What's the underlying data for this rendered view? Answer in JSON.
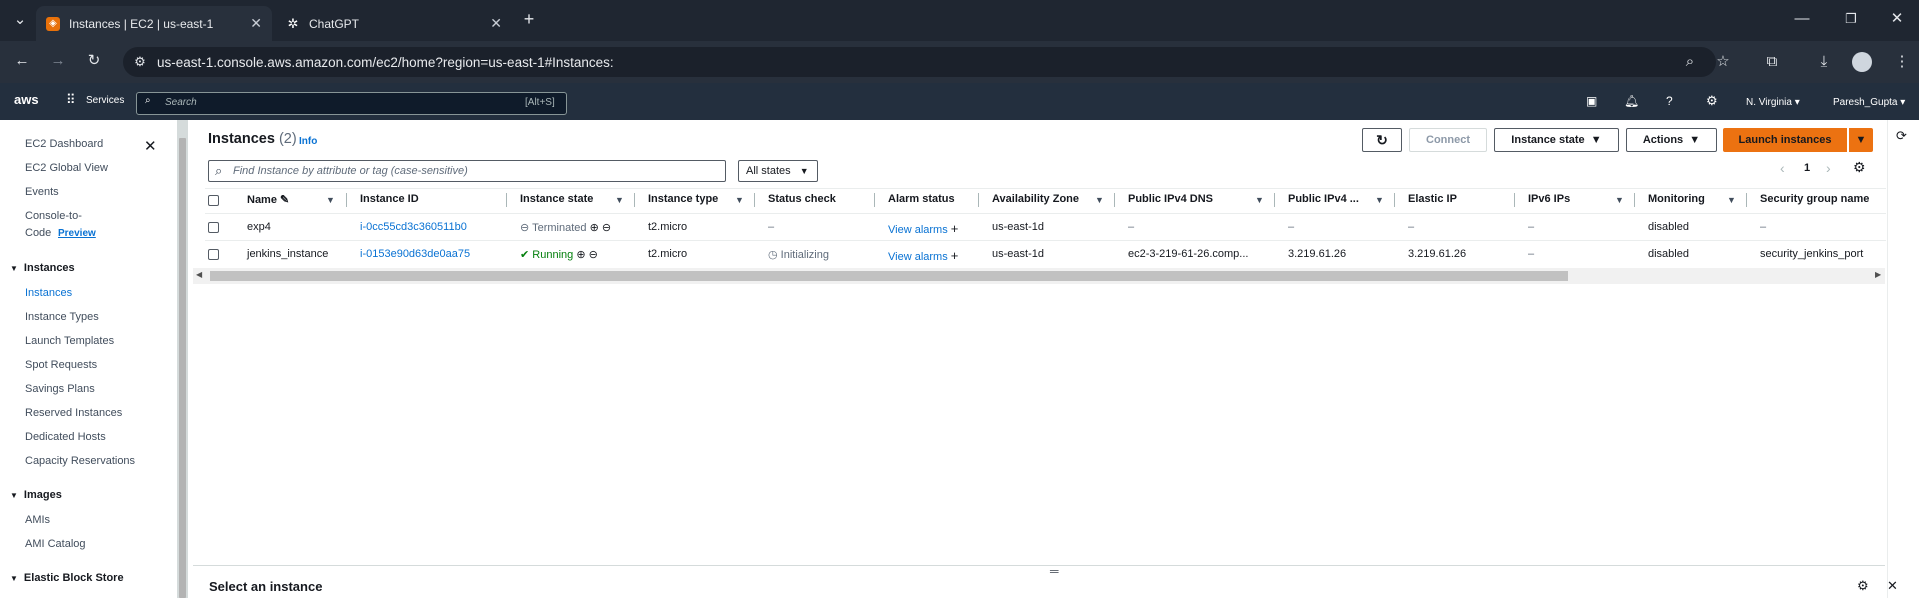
{
  "browser": {
    "tabs": [
      {
        "title": "Instances | EC2 | us-east-1",
        "active": true
      },
      {
        "title": "ChatGPT",
        "active": false
      }
    ],
    "url": "us-east-1.console.aws.amazon.com/ec2/home?region=us-east-1#Instances:"
  },
  "aws_nav": {
    "logo": "aws",
    "services": "Services",
    "search_placeholder": "Search",
    "search_shortcut": "[Alt+S]",
    "region": "N. Virginia",
    "user": "Paresh_Gupta"
  },
  "sidebar": {
    "top_items": [
      "EC2 Dashboard",
      "EC2 Global View",
      "Events",
      "Console-to-",
      "Code"
    ],
    "preview_badge": "Preview",
    "sections": [
      {
        "title": "Instances",
        "items": [
          "Instances",
          "Instance Types",
          "Launch Templates",
          "Spot Requests",
          "Savings Plans",
          "Reserved Instances",
          "Dedicated Hosts",
          "Capacity Reservations"
        ]
      },
      {
        "title": "Images",
        "items": [
          "AMIs",
          "AMI Catalog"
        ]
      },
      {
        "title": "Elastic Block Store",
        "items": []
      }
    ]
  },
  "main": {
    "title": "Instances",
    "count": "(2)",
    "info": "Info",
    "buttons": {
      "connect": "Connect",
      "instance_state": "Instance state",
      "actions": "Actions",
      "launch": "Launch instances"
    },
    "filter_placeholder": "Find Instance by attribute or tag (case-sensitive)",
    "state_filter": "All states",
    "page": "1",
    "columns": [
      "Name",
      "Instance ID",
      "Instance state",
      "Instance type",
      "Status check",
      "Alarm status",
      "Availability Zone",
      "Public IPv4 DNS",
      "Public IPv4 ...",
      "Elastic IP",
      "IPv6 IPs",
      "Monitoring",
      "Security group name"
    ],
    "rows": [
      {
        "name": "exp4",
        "id": "i-0cc55cd3c360511b0",
        "state": "Terminated",
        "type": "t2.micro",
        "status": "–",
        "alarm": "View alarms",
        "az": "us-east-1d",
        "dns": "–",
        "ipv4": "–",
        "eip": "–",
        "ipv6": "–",
        "monitoring": "disabled",
        "sg": "–"
      },
      {
        "name": "jenkins_instance",
        "id": "i-0153e90d63de0aa75",
        "state": "Running",
        "type": "t2.micro",
        "status": "Initializing",
        "alarm": "View alarms",
        "az": "us-east-1d",
        "dns": "ec2-3-219-61-26.comp...",
        "ipv4": "3.219.61.26",
        "eip": "3.219.61.26",
        "ipv6": "–",
        "monitoring": "disabled",
        "sg": "security_jenkins_port"
      }
    ],
    "bottom_title": "Select an instance"
  },
  "colors": {
    "aws_nav": "#232f3e",
    "accent": "#ec7211",
    "link": "#0972d3",
    "running": "#037f0c"
  }
}
